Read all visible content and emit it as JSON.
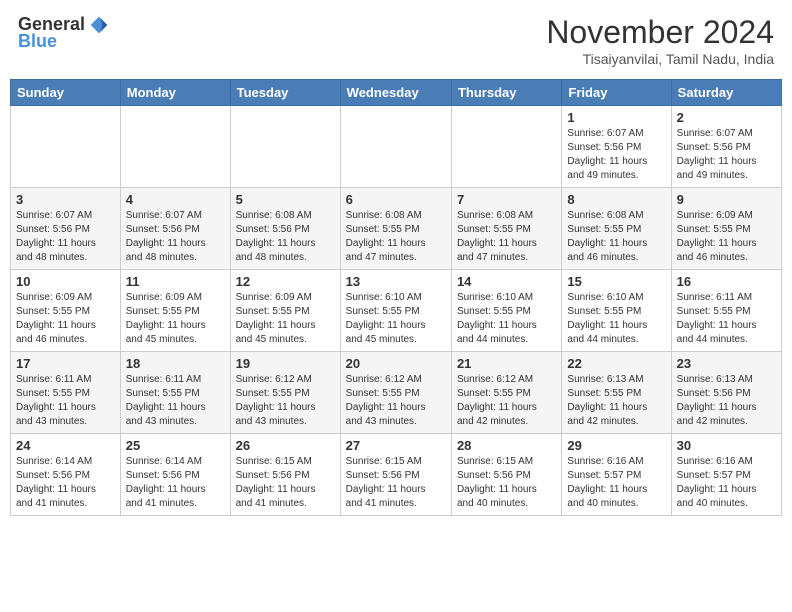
{
  "header": {
    "logo_general": "General",
    "logo_blue": "Blue",
    "month_title": "November 2024",
    "location": "Tisaiyanvilai, Tamil Nadu, India"
  },
  "days_of_week": [
    "Sunday",
    "Monday",
    "Tuesday",
    "Wednesday",
    "Thursday",
    "Friday",
    "Saturday"
  ],
  "weeks": [
    [
      {
        "day": "",
        "info": ""
      },
      {
        "day": "",
        "info": ""
      },
      {
        "day": "",
        "info": ""
      },
      {
        "day": "",
        "info": ""
      },
      {
        "day": "",
        "info": ""
      },
      {
        "day": "1",
        "info": "Sunrise: 6:07 AM\nSunset: 5:56 PM\nDaylight: 11 hours\nand 49 minutes."
      },
      {
        "day": "2",
        "info": "Sunrise: 6:07 AM\nSunset: 5:56 PM\nDaylight: 11 hours\nand 49 minutes."
      }
    ],
    [
      {
        "day": "3",
        "info": "Sunrise: 6:07 AM\nSunset: 5:56 PM\nDaylight: 11 hours\nand 48 minutes."
      },
      {
        "day": "4",
        "info": "Sunrise: 6:07 AM\nSunset: 5:56 PM\nDaylight: 11 hours\nand 48 minutes."
      },
      {
        "day": "5",
        "info": "Sunrise: 6:08 AM\nSunset: 5:56 PM\nDaylight: 11 hours\nand 48 minutes."
      },
      {
        "day": "6",
        "info": "Sunrise: 6:08 AM\nSunset: 5:55 PM\nDaylight: 11 hours\nand 47 minutes."
      },
      {
        "day": "7",
        "info": "Sunrise: 6:08 AM\nSunset: 5:55 PM\nDaylight: 11 hours\nand 47 minutes."
      },
      {
        "day": "8",
        "info": "Sunrise: 6:08 AM\nSunset: 5:55 PM\nDaylight: 11 hours\nand 46 minutes."
      },
      {
        "day": "9",
        "info": "Sunrise: 6:09 AM\nSunset: 5:55 PM\nDaylight: 11 hours\nand 46 minutes."
      }
    ],
    [
      {
        "day": "10",
        "info": "Sunrise: 6:09 AM\nSunset: 5:55 PM\nDaylight: 11 hours\nand 46 minutes."
      },
      {
        "day": "11",
        "info": "Sunrise: 6:09 AM\nSunset: 5:55 PM\nDaylight: 11 hours\nand 45 minutes."
      },
      {
        "day": "12",
        "info": "Sunrise: 6:09 AM\nSunset: 5:55 PM\nDaylight: 11 hours\nand 45 minutes."
      },
      {
        "day": "13",
        "info": "Sunrise: 6:10 AM\nSunset: 5:55 PM\nDaylight: 11 hours\nand 45 minutes."
      },
      {
        "day": "14",
        "info": "Sunrise: 6:10 AM\nSunset: 5:55 PM\nDaylight: 11 hours\nand 44 minutes."
      },
      {
        "day": "15",
        "info": "Sunrise: 6:10 AM\nSunset: 5:55 PM\nDaylight: 11 hours\nand 44 minutes."
      },
      {
        "day": "16",
        "info": "Sunrise: 6:11 AM\nSunset: 5:55 PM\nDaylight: 11 hours\nand 44 minutes."
      }
    ],
    [
      {
        "day": "17",
        "info": "Sunrise: 6:11 AM\nSunset: 5:55 PM\nDaylight: 11 hours\nand 43 minutes."
      },
      {
        "day": "18",
        "info": "Sunrise: 6:11 AM\nSunset: 5:55 PM\nDaylight: 11 hours\nand 43 minutes."
      },
      {
        "day": "19",
        "info": "Sunrise: 6:12 AM\nSunset: 5:55 PM\nDaylight: 11 hours\nand 43 minutes."
      },
      {
        "day": "20",
        "info": "Sunrise: 6:12 AM\nSunset: 5:55 PM\nDaylight: 11 hours\nand 43 minutes."
      },
      {
        "day": "21",
        "info": "Sunrise: 6:12 AM\nSunset: 5:55 PM\nDaylight: 11 hours\nand 42 minutes."
      },
      {
        "day": "22",
        "info": "Sunrise: 6:13 AM\nSunset: 5:55 PM\nDaylight: 11 hours\nand 42 minutes."
      },
      {
        "day": "23",
        "info": "Sunrise: 6:13 AM\nSunset: 5:56 PM\nDaylight: 11 hours\nand 42 minutes."
      }
    ],
    [
      {
        "day": "24",
        "info": "Sunrise: 6:14 AM\nSunset: 5:56 PM\nDaylight: 11 hours\nand 41 minutes."
      },
      {
        "day": "25",
        "info": "Sunrise: 6:14 AM\nSunset: 5:56 PM\nDaylight: 11 hours\nand 41 minutes."
      },
      {
        "day": "26",
        "info": "Sunrise: 6:15 AM\nSunset: 5:56 PM\nDaylight: 11 hours\nand 41 minutes."
      },
      {
        "day": "27",
        "info": "Sunrise: 6:15 AM\nSunset: 5:56 PM\nDaylight: 11 hours\nand 41 minutes."
      },
      {
        "day": "28",
        "info": "Sunrise: 6:15 AM\nSunset: 5:56 PM\nDaylight: 11 hours\nand 40 minutes."
      },
      {
        "day": "29",
        "info": "Sunrise: 6:16 AM\nSunset: 5:57 PM\nDaylight: 11 hours\nand 40 minutes."
      },
      {
        "day": "30",
        "info": "Sunrise: 6:16 AM\nSunset: 5:57 PM\nDaylight: 11 hours\nand 40 minutes."
      }
    ]
  ]
}
